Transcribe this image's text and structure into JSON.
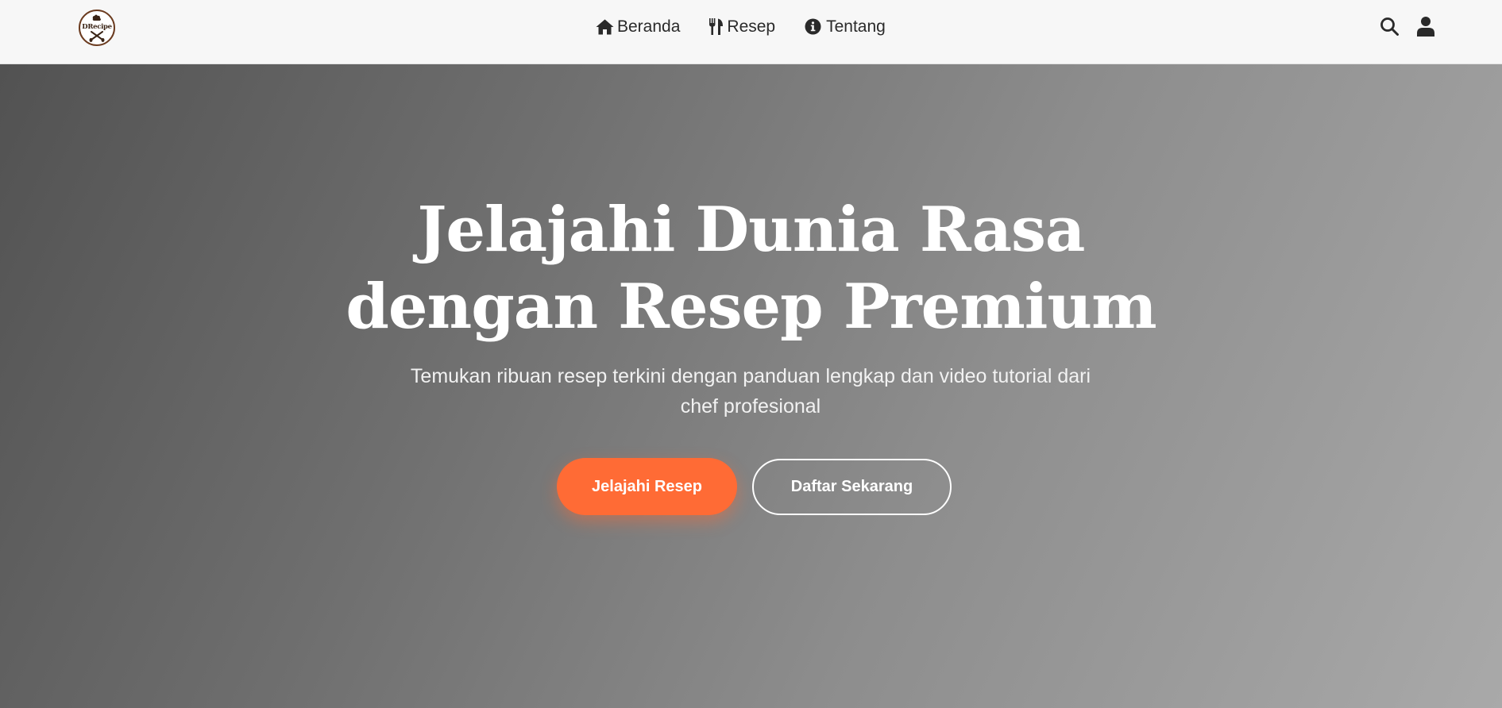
{
  "brand": {
    "logo_text": "DRecipe"
  },
  "nav": {
    "items": [
      {
        "label": "Beranda",
        "icon": "home-icon"
      },
      {
        "label": "Resep",
        "icon": "utensils-icon"
      },
      {
        "label": "Tentang",
        "icon": "info-circle-icon"
      }
    ],
    "actions": [
      {
        "icon": "search-icon"
      },
      {
        "icon": "user-icon"
      }
    ]
  },
  "hero": {
    "title_line1": "Jelajahi Dunia Rasa",
    "title_line2": "dengan Resep Premium",
    "subtitle_line1": "Temukan ribuan resep terkini dengan panduan lengkap dan video tutorial dari",
    "subtitle_line2": "chef profesional",
    "primary_button": "Jelajahi Resep",
    "secondary_button": "Daftar Sekarang"
  },
  "colors": {
    "accent": "#ff6b35",
    "navbar_bg": "#f7f7f7",
    "nav_text": "#2a2a2a",
    "hero_gradient_start": "#525252",
    "hero_gradient_end": "#a9a9a9",
    "text_light": "#ffffff"
  }
}
